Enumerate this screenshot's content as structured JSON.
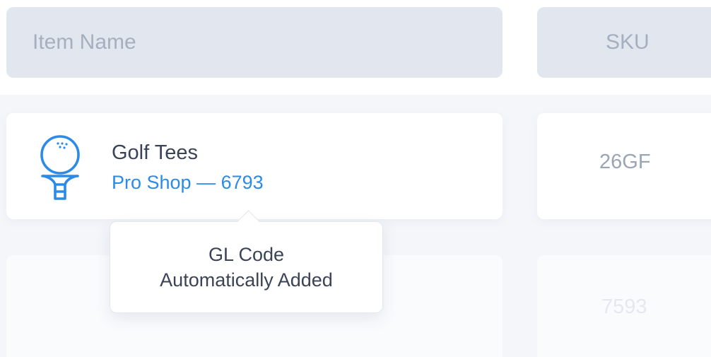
{
  "table": {
    "columns": [
      "Item Name",
      "SKU"
    ],
    "rows": [
      {
        "icon": "golf-ball-on-tee-icon",
        "name": "Golf Tees",
        "subtitle": "Pro Shop — 6793",
        "sku": "26GF"
      },
      {
        "name": "",
        "subtitle": "",
        "sku": "7593"
      }
    ]
  },
  "tooltip": {
    "line1": "GL Code",
    "line2": "Automatically Added"
  },
  "colors": {
    "accent": "#2b8be6",
    "header_bg": "#e2e7ef",
    "header_text": "#a5afbf",
    "title_text": "#3a4456"
  }
}
